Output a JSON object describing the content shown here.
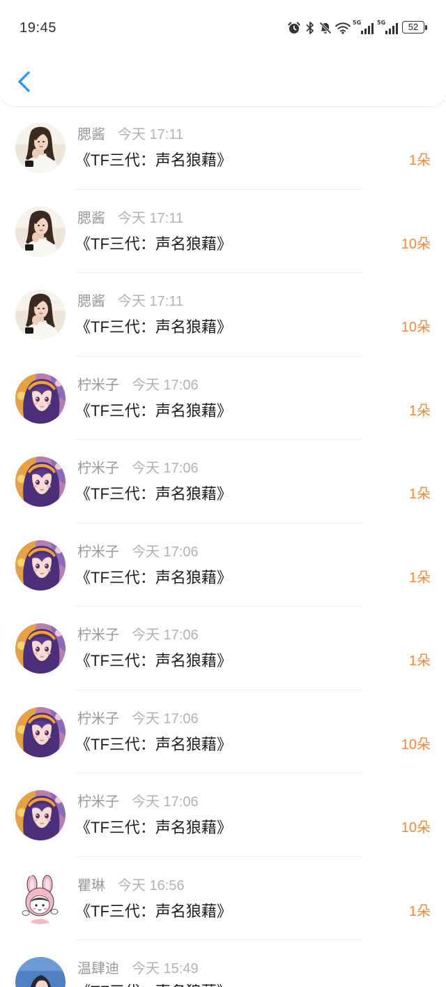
{
  "status_bar": {
    "time": "19:45",
    "network_1": "5G",
    "network_2": "5G",
    "battery_level": "52",
    "icons": [
      "alarm-icon",
      "bluetooth-icon",
      "bell-off-icon",
      "wifi-icon",
      "signal-bars-icon",
      "signal-bars-icon",
      "battery-icon"
    ]
  },
  "header": {
    "back_icon": "chevron-left-icon"
  },
  "colors": {
    "accent": "#2e9bf2",
    "amount": "#ef8a3c",
    "name": "#999999",
    "time": "#b2b2b2",
    "title": "#1e1e1e",
    "divider": "#efefef"
  },
  "items": [
    {
      "avatar": "woman-photo-avatar",
      "name": "腮酱",
      "time": "今天 17:11",
      "title": "《TF三代：声名狼藉》",
      "amount": "1朵"
    },
    {
      "avatar": "woman-photo-avatar",
      "name": "腮酱",
      "time": "今天 17:11",
      "title": "《TF三代：声名狼藉》",
      "amount": "10朵"
    },
    {
      "avatar": "woman-photo-avatar",
      "name": "腮酱",
      "time": "今天 17:11",
      "title": "《TF三代：声名狼藉》",
      "amount": "10朵"
    },
    {
      "avatar": "anime-girl-avatar",
      "name": "柠米子",
      "time": "今天 17:06",
      "title": "《TF三代：声名狼藉》",
      "amount": "1朵"
    },
    {
      "avatar": "anime-girl-avatar",
      "name": "柠米子",
      "time": "今天 17:06",
      "title": "《TF三代：声名狼藉》",
      "amount": "1朵"
    },
    {
      "avatar": "anime-girl-avatar",
      "name": "柠米子",
      "time": "今天 17:06",
      "title": "《TF三代：声名狼藉》",
      "amount": "1朵"
    },
    {
      "avatar": "anime-girl-avatar",
      "name": "柠米子",
      "time": "今天 17:06",
      "title": "《TF三代：声名狼藉》",
      "amount": "1朵"
    },
    {
      "avatar": "anime-girl-avatar",
      "name": "柠米子",
      "time": "今天 17:06",
      "title": "《TF三代：声名狼藉》",
      "amount": "10朵"
    },
    {
      "avatar": "anime-girl-avatar",
      "name": "柠米子",
      "time": "今天 17:06",
      "title": "《TF三代：声名狼藉》",
      "amount": "10朵"
    },
    {
      "avatar": "bunny-cartoon-avatar",
      "name": "瞿琳",
      "time": "今天 16:56",
      "title": "《TF三代：声名狼藉》",
      "amount": "1朵"
    },
    {
      "avatar": "blue-photo-avatar",
      "name": "温肆迪",
      "time": "今天 15:49",
      "title": "《TF三代：声名狼藉》"
    }
  ]
}
